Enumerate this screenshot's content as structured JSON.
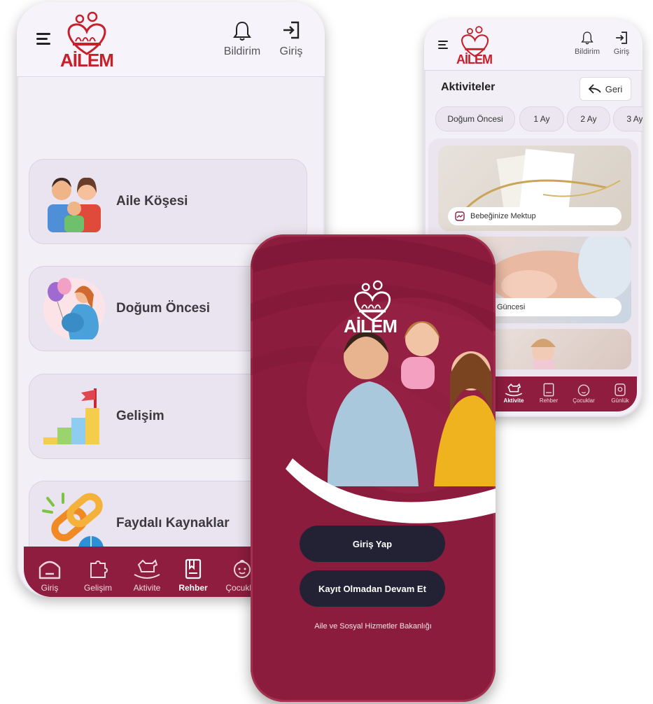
{
  "phone_home": {
    "header": {
      "logo_text": "AİLEM",
      "notify_label": "Bildirim",
      "login_label": "Giriş"
    },
    "menu_items": [
      {
        "label": "Aile Köşesi",
        "icon": "family-icon"
      },
      {
        "label": "Doğum Öncesi",
        "icon": "pregnant-icon"
      },
      {
        "label": "Gelişim",
        "icon": "growth-steps-icon"
      },
      {
        "label": "Faydalı Kaynaklar",
        "icon": "link-globe-icon"
      }
    ],
    "bottom_nav": [
      {
        "label": "Giriş",
        "icon": "home-icon"
      },
      {
        "label": "Gelişim",
        "icon": "puzzle-icon"
      },
      {
        "label": "Aktivite",
        "icon": "rocking-horse-icon"
      },
      {
        "label": "Rehber",
        "icon": "book-icon"
      },
      {
        "label": "Çocuklar",
        "icon": "child-face-icon"
      }
    ]
  },
  "phone_activities": {
    "header": {
      "logo_text": "AİLEM",
      "notify_label": "Bildirim",
      "login_label": "Giriş"
    },
    "page_title": "Aktiviteler",
    "back_label": "Geri",
    "chips": [
      "Doğum Öncesi",
      "1 Ay",
      "2 Ay",
      "3 Ay"
    ],
    "cards": [
      {
        "label": "Bebeğinize Mektup"
      },
      {
        "label": "Güncesi"
      },
      {
        "label": ""
      }
    ],
    "bottom_nav": [
      {
        "label": "Aktivite"
      },
      {
        "label": "Rehber"
      },
      {
        "label": "Çocuklar"
      },
      {
        "label": "Günlük"
      }
    ]
  },
  "phone_splash": {
    "logo_text": "AİLEM",
    "login_button": "Giriş Yap",
    "guest_button": "Kayıt Olmadan Devam Et",
    "footer": "Aile ve Sosyal Hizmetler Bakanlığı"
  },
  "colors": {
    "brand": "#8c1c3e",
    "logo_red": "#c8202a",
    "button_dark": "#232235",
    "card_bg": "#e9e4ef"
  }
}
